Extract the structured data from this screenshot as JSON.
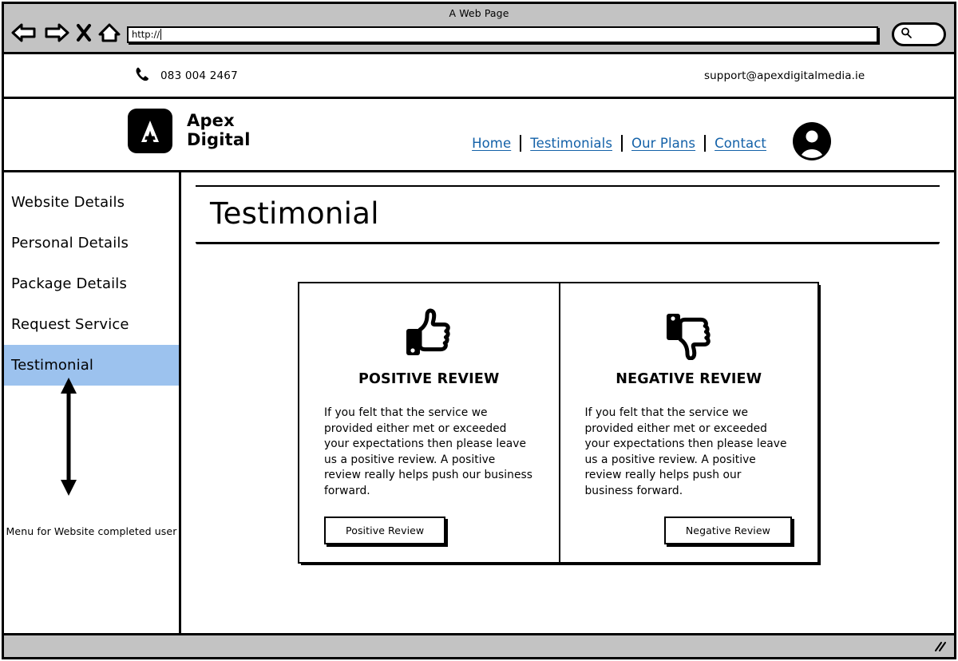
{
  "browser": {
    "title": "A Web Page",
    "url_value": "http://",
    "back_icon": "back-arrow-icon",
    "forward_icon": "forward-arrow-icon",
    "stop_icon": "close-x-icon",
    "home_icon": "home-icon",
    "search_icon": "search-icon"
  },
  "contact_bar": {
    "phone_icon": "phone-icon",
    "phone": "083 004 2467",
    "email": "support@apexdigitalmedia.ie"
  },
  "brand": {
    "logo_letter": "A",
    "name_line1": "Apex",
    "name_line2": "Digital"
  },
  "nav": {
    "items": [
      {
        "label": "Home"
      },
      {
        "label": "Testimonials"
      },
      {
        "label": "Our Plans"
      },
      {
        "label": "Contact"
      }
    ],
    "avatar_icon": "user-avatar-icon"
  },
  "sidebar": {
    "items": [
      {
        "label": "Website Details",
        "active": false
      },
      {
        "label": "Personal Details",
        "active": false
      },
      {
        "label": "Package Details",
        "active": false
      },
      {
        "label": "Request Service",
        "active": false
      },
      {
        "label": "Testimonial",
        "active": true
      }
    ],
    "active_color": "#9cc2ee",
    "arrow_icon": "double-headed-vertical-arrow-icon",
    "caption": "Menu for Website completed user"
  },
  "main": {
    "page_title": "Testimonial",
    "cards": [
      {
        "icon": "thumbs-up-icon",
        "title": "POSITIVE REVIEW",
        "body": "If you felt that the service we provided either met or exceeded your expectations then please leave us a positive review. A positive review really helps push our business forward.",
        "button_label": "Positive Review"
      },
      {
        "icon": "thumbs-down-icon",
        "title": "NEGATIVE REVIEW",
        "body": "If you felt that the service we provided either met or exceeded your expectations then please leave us a positive review. A positive review really helps push our business forward.",
        "button_label": "Negative Review"
      }
    ]
  },
  "status_bar": {
    "resize_grip_icon": "resize-grip-icon"
  },
  "colors": {
    "link_blue": "#1361a8",
    "highlight_blue": "#9cc2ee",
    "chrome_gray": "#c3c3c3",
    "ink": "#000000"
  }
}
